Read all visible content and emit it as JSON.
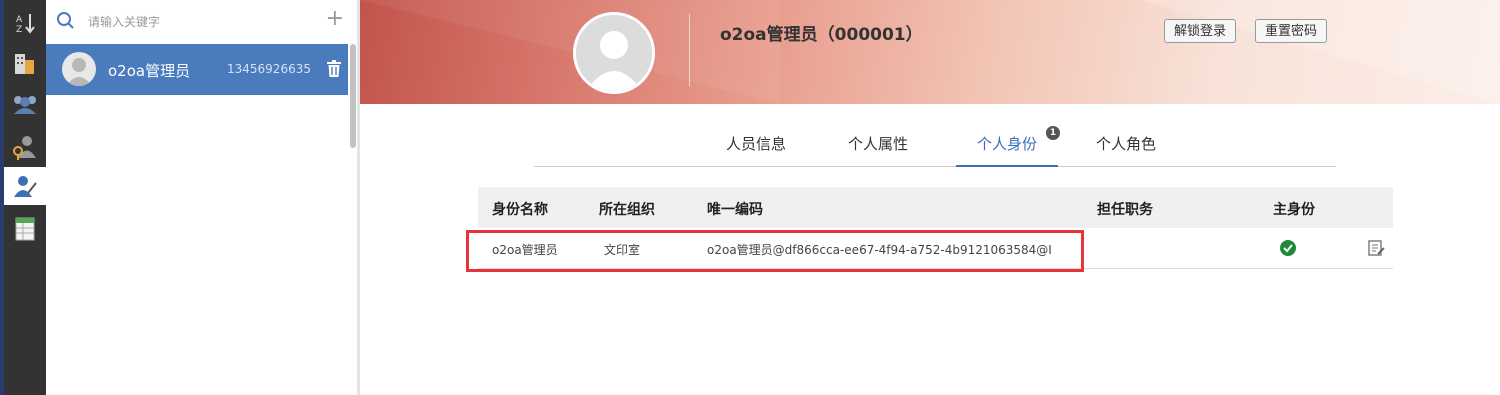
{
  "sidebar_icons": [
    "sort-az-icon",
    "organization-icon",
    "group-icon",
    "role-icon",
    "person-edit-icon",
    "spreadsheet-icon"
  ],
  "search": {
    "placeholder": "请输入关键字",
    "add_label": "+"
  },
  "person_list": [
    {
      "name": "o2oa管理员",
      "phone": "13456926635"
    }
  ],
  "profile": {
    "title": "o2oa管理员（000001）",
    "unlock_label": "解锁登录",
    "reset_label": "重置密码"
  },
  "tabs": [
    {
      "label": "人员信息",
      "active": false
    },
    {
      "label": "个人属性",
      "active": false
    },
    {
      "label": "个人身份",
      "active": true,
      "badge": "1"
    },
    {
      "label": "个人角色",
      "active": false
    }
  ],
  "table": {
    "headers": [
      "身份名称",
      "所在组织",
      "唯一编码",
      "担任职务",
      "主身份"
    ],
    "rows": [
      {
        "name": "o2oa管理员",
        "org": "文印室",
        "code": "o2oa管理员@df866cca-ee67-4f94-a752-4b9121063584@I",
        "duty": "",
        "main": true
      }
    ]
  },
  "colors": {
    "accent": "#3c70b6",
    "selected_row": "#4a7bbd",
    "highlight": "#e8333a",
    "check": "#1f8a3a"
  }
}
